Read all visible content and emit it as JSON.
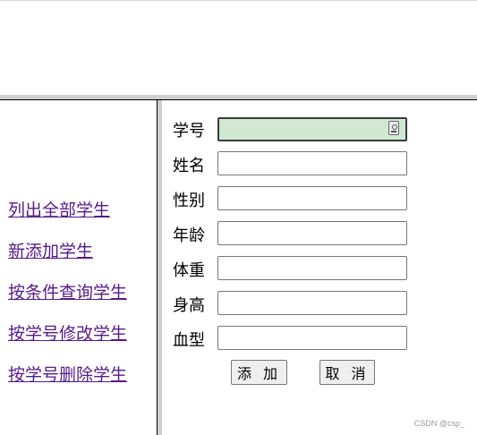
{
  "nav": {
    "items": [
      {
        "label": "列出全部学生"
      },
      {
        "label": "新添加学生"
      },
      {
        "label": "按条件查询学生"
      },
      {
        "label": "按学号修改学生"
      },
      {
        "label": "按学号删除学生"
      }
    ]
  },
  "form": {
    "fields": [
      {
        "label": "学号",
        "value": ""
      },
      {
        "label": "姓名",
        "value": ""
      },
      {
        "label": "性别",
        "value": ""
      },
      {
        "label": "年龄",
        "value": ""
      },
      {
        "label": "体重",
        "value": ""
      },
      {
        "label": "身高",
        "value": ""
      },
      {
        "label": "血型",
        "value": ""
      }
    ],
    "add_label": "添 加",
    "cancel_label": "取 消"
  },
  "watermark": "CSDN @csp_",
  "colors": {
    "link": "#551a8b",
    "focused_input": "#cfe8cf",
    "frame_divider": "#cfcfcf"
  }
}
